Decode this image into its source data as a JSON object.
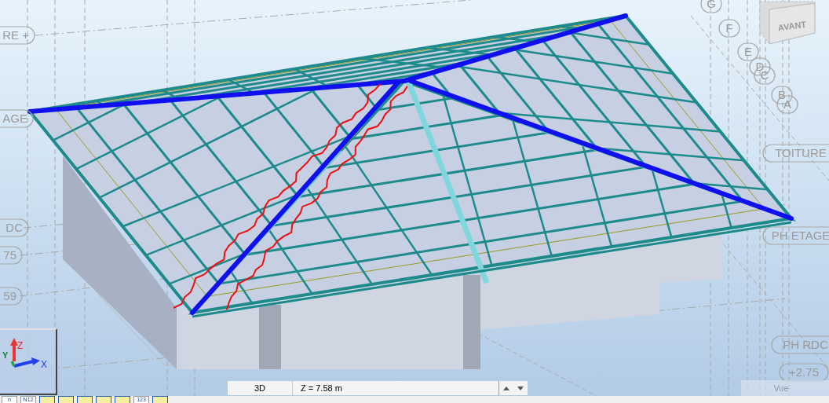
{
  "viewport": {
    "grid_labels": [
      {
        "text": "RE +"
      },
      {
        "text": "AGE"
      },
      {
        "text": "DC"
      },
      {
        "text": "75"
      },
      {
        "text": "59"
      },
      {
        "text": "G"
      },
      {
        "text": "F"
      },
      {
        "text": "E"
      },
      {
        "text": "D"
      },
      {
        "text": "C"
      },
      {
        "text": "B"
      },
      {
        "text": "A"
      },
      {
        "text": "TOITURE"
      },
      {
        "text": "PH ETAGE"
      },
      {
        "text": "PH RDC"
      },
      {
        "text": "+2.75"
      }
    ]
  },
  "view_cube": {
    "face": "AVANT"
  },
  "axes": {
    "z": "Z",
    "y": "Y",
    "x": "X"
  },
  "view_bar": {
    "view": "3D",
    "level": "Z = 7.58 m"
  },
  "side_panel": {
    "title": "Vue"
  },
  "toolbar": {
    "items": [
      {
        "kind": "text",
        "label": "n"
      },
      {
        "kind": "text",
        "label": "N12"
      },
      {
        "kind": "icon"
      },
      {
        "kind": "icon"
      },
      {
        "kind": "icon"
      },
      {
        "kind": "icon"
      },
      {
        "kind": "icon"
      },
      {
        "kind": "text",
        "label": "123"
      },
      {
        "kind": "icon"
      }
    ]
  }
}
